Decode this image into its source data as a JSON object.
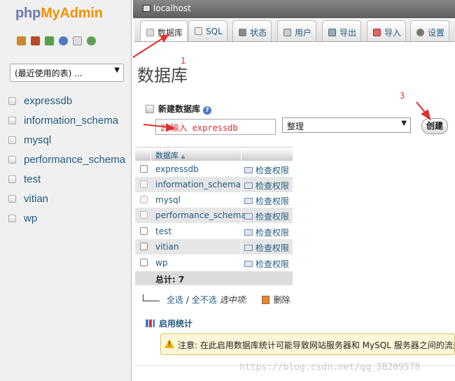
{
  "sidebar": {
    "logo": {
      "php": "php",
      "my": "My",
      "admin": "Admin"
    },
    "quick_icons": [
      "home-icon",
      "database-icon",
      "exit-icon",
      "help-icon",
      "docs-icon",
      "settings-icon"
    ],
    "recent_tables_label": "(最近使用的表) ...",
    "databases": [
      "expressdb",
      "information_schema",
      "mysql",
      "performance_schema",
      "test",
      "vitian",
      "wp"
    ]
  },
  "server_bar": {
    "label": "localhost"
  },
  "tabs": [
    {
      "label": "数据库",
      "icon": "database-icon"
    },
    {
      "label": "SQL",
      "icon": "sql-icon"
    },
    {
      "label": "状态",
      "icon": "status-icon"
    },
    {
      "label": "用户",
      "icon": "users-icon"
    },
    {
      "label": "导出",
      "icon": "export-icon"
    },
    {
      "label": "导入",
      "icon": "import-icon"
    },
    {
      "label": "设置",
      "icon": "settings-icon"
    }
  ],
  "page_title": "数据库",
  "create_db": {
    "label": "新建数据库",
    "name_value": "2 输入 expressdb",
    "collation_value": "整理",
    "create_button": "创建"
  },
  "db_table": {
    "header": "数据库",
    "rows": [
      {
        "name": "expressdb",
        "action": "检查权限"
      },
      {
        "name": "information_schema",
        "action": "检查权限"
      },
      {
        "name": "mysql",
        "action": "检查权限"
      },
      {
        "name": "performance_schema",
        "action": "检查权限"
      },
      {
        "name": "test",
        "action": "检查权限"
      },
      {
        "name": "vitian",
        "action": "检查权限"
      },
      {
        "name": "wp",
        "action": "检查权限"
      }
    ],
    "total": "总计: 7"
  },
  "bulk": {
    "select_all": "全选",
    "separator": " / ",
    "select_none": "全不选",
    "with_selected": "选中项:",
    "drop": "删除"
  },
  "stats": {
    "enable_label": "启用统计",
    "notice": "注意: 在此启用数据库统计可能导致网站服务器和 MySQL 服务器之间的流量"
  },
  "annotations": {
    "one": "1",
    "three": "3"
  },
  "watermark": "https://blog.csdn.net/qq_38209578",
  "colors": {
    "link": "#235a81",
    "annotation": "#e03030",
    "logo_php": "#6c78af",
    "logo_admin": "#f29200"
  }
}
